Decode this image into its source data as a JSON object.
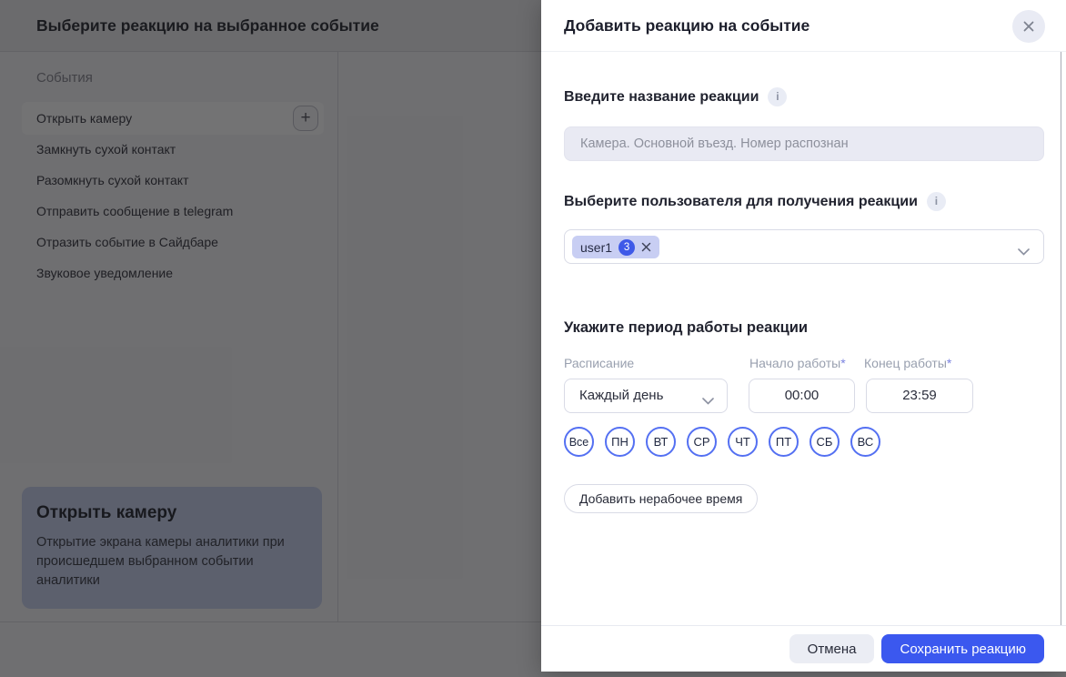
{
  "background_page": {
    "title": "Выберите реакцию на выбранное событие",
    "events": {
      "section_label": "События",
      "items": [
        "Открыть камеру",
        "Замкнуть сухой контакт",
        "Разомкнуть сухой контакт",
        "Отправить сообщение в telegram",
        "Отразить событие в Сайдбаре",
        "Звуковое уведомление"
      ],
      "selected_item": "Открыть камеру",
      "add_icon_glyph": "+"
    },
    "info_card": {
      "title": "Открыть камеру",
      "description": "Открытие экрана камеры аналитики при происшедшем выбранном событии аналитики"
    }
  },
  "modal": {
    "title": "Добавить реакцию на событие",
    "name_field": {
      "label": "Введите название реакции",
      "info_icon_glyph": "i",
      "value": "Камера. Основной въезд. Номер распознан"
    },
    "user_field": {
      "label": "Выберите пользователя для получения реакции",
      "info_icon_glyph": "i",
      "chip": {
        "text": "user1",
        "count": "3"
      }
    },
    "period": {
      "title": "Укажите период работы реакции",
      "schedule_label": "Расписание",
      "schedule_value": "Каждый день",
      "start_label": "Начало работы",
      "start_required_mark": "*",
      "start_value": "00:00",
      "end_label": "Конец работы",
      "end_required_mark": "*",
      "end_value": "23:59",
      "days": [
        "Все",
        "ПН",
        "ВТ",
        "СР",
        "ЧТ",
        "ПТ",
        "СБ",
        "ВС"
      ],
      "add_downtime_label": "Добавить нерабочее время"
    },
    "footer": {
      "cancel_label": "Отмена",
      "save_label": "Сохранить реакцию"
    }
  },
  "colors": {
    "accent_blue": "#3b58ef",
    "day_circle_border": "#5470f2",
    "chip_background": "#c8cef3",
    "badge_blue": "#3e59e8",
    "card_background": "#c9d2ee",
    "input_background": "#e9eaf3",
    "overlay": "rgba(8,8,10,0.57)"
  }
}
